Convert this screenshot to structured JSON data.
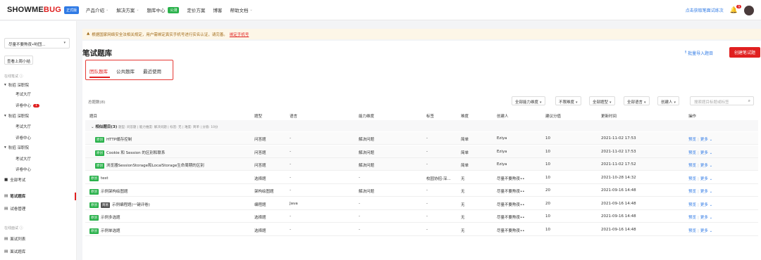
{
  "header": {
    "logo_text_a": "SHOWME",
    "logo_text_b": "BUG",
    "logo_badge": "正式版",
    "nav": [
      {
        "label": "产品介绍",
        "chevron": true
      },
      {
        "label": "解决方案",
        "chevron": true
      },
      {
        "label": "题库中心",
        "badge": "公测"
      },
      {
        "label": "定价方案"
      },
      {
        "label": "博客"
      },
      {
        "label": "帮助文档",
        "chevron": true
      }
    ],
    "interview_link": "点击获取笔面试练次",
    "bell_count": "9"
  },
  "sidebar": {
    "org_select": "尽量不要熬夜•哟団...",
    "week_button": "查看上周小结",
    "section_written": "在线笔试",
    "section_interview": "在线面试",
    "tree": [
      {
        "label": "秋招 深职院",
        "level": 0
      },
      {
        "label": "考试大厅",
        "level": 1
      },
      {
        "label": "评卷中心",
        "level": 1,
        "badge": "1"
      },
      {
        "label": "秋招 深职院",
        "level": 0
      },
      {
        "label": "考试大厅",
        "level": 1
      },
      {
        "label": "评卷中心",
        "level": 1
      },
      {
        "label": "秋招 深职院",
        "level": 0
      },
      {
        "label": "考试大厅",
        "level": 1
      },
      {
        "label": "评卷中心",
        "level": 1
      },
      {
        "label": "全部考试",
        "level": 0
      }
    ],
    "menu": [
      {
        "label": "笔试题库",
        "active": true
      },
      {
        "label": "试卷管理"
      }
    ],
    "interview_menu": [
      {
        "label": "面试列表"
      },
      {
        "label": "面试题库"
      }
    ]
  },
  "notice": {
    "text": "根据国家网络安全法相关规定，用户需绑定真实手机号进行实名认证，请完善。",
    "link": "绑定手机号"
  },
  "main": {
    "title": "笔试题库",
    "import_label": "批量导入题目",
    "create_label": "创建笔试题",
    "tabs": [
      "团队题库",
      "公共题库",
      "最近使用"
    ],
    "total_label": "总题数(8)",
    "filters": [
      "全部能力维度",
      "不限难度",
      "全部题型",
      "全部语言",
      "创建人"
    ],
    "search_placeholder": "搜索题目标题或标签",
    "columns": [
      "题目",
      "题型",
      "语言",
      "能力维度",
      "标签",
      "难度",
      "创建人",
      "建议分值",
      "更新时间",
      "操作"
    ],
    "group": {
      "title": "相似题目(3)",
      "meta": "题型: 问答题 | 能力维度: 解决问题 | 标签: 无 | 难度: 简单 | 分值: 10分"
    },
    "rows": [
      {
        "tag": "原创",
        "tag_color": "green",
        "title": "HTTP缓存控制",
        "type": "问答题",
        "lang": "-",
        "ability": "解决问题",
        "label": "-",
        "difficulty": "简单",
        "creator": "Eziya",
        "score": "10",
        "updated": "2021-11-02 17:53",
        "child": true
      },
      {
        "tag": "原创",
        "tag_color": "green",
        "title": "Cookie 和 Session 的区别和联系",
        "type": "问答题",
        "lang": "-",
        "ability": "解决问题",
        "label": "-",
        "difficulty": "简单",
        "creator": "Eziya",
        "score": "10",
        "updated": "2021-11-02 17:53",
        "child": true
      },
      {
        "tag": "原创",
        "tag_color": "green",
        "title": "浏览器SessionStorage和LocalStorage生命周期的区别",
        "type": "问答题",
        "lang": "-",
        "ability": "解决问题",
        "label": "-",
        "difficulty": "简单",
        "creator": "Eziya",
        "score": "10",
        "updated": "2021-11-02 17:52",
        "child": true
      },
      {
        "tag": "原创",
        "tag_color": "green",
        "title": "test",
        "type": "选择题",
        "lang": "-",
        "ability": "-",
        "label": "校园协招-深...",
        "difficulty": "无",
        "creator": "尽量不要熬夜••",
        "score": "10",
        "updated": "2021-10-28 14:32",
        "child": false
      },
      {
        "tag": "原创",
        "tag_color": "green",
        "title": "示例架构绘图题",
        "type": "架构绘图题",
        "lang": "-",
        "ability": "解决问题",
        "label": "-",
        "difficulty": "无",
        "creator": "尽量不要熬夜••",
        "score": "20",
        "updated": "2021-09-16 14:48",
        "child": false
      },
      {
        "tag": "原创",
        "tag2": "简易",
        "tag_color": "green",
        "title": "示例编程题(一键评卷)",
        "type": "编程题",
        "lang": "Java",
        "ability": "-",
        "label": "-",
        "difficulty": "无",
        "creator": "尽量不要熬夜••",
        "score": "20",
        "updated": "2021-09-16 14:48",
        "child": false
      },
      {
        "tag": "原创",
        "tag_color": "green",
        "title": "示例多选题",
        "type": "选择题",
        "lang": "-",
        "ability": "-",
        "label": "-",
        "difficulty": "无",
        "creator": "尽量不要熬夜••",
        "score": "10",
        "updated": "2021-09-16 14:48",
        "child": false
      },
      {
        "tag": "原创",
        "tag_color": "green",
        "title": "示例单选题",
        "type": "选择题",
        "lang": "-",
        "ability": "-",
        "label": "-",
        "difficulty": "无",
        "creator": "尽量不要熬夜••",
        "score": "10",
        "updated": "2021-09-16 14:48",
        "child": false
      }
    ],
    "op_preview": "预览",
    "op_more": "更多"
  },
  "colors": {
    "accent": "#e02020",
    "link": "#2f7ae5",
    "tag_green": "#2bb24c"
  }
}
